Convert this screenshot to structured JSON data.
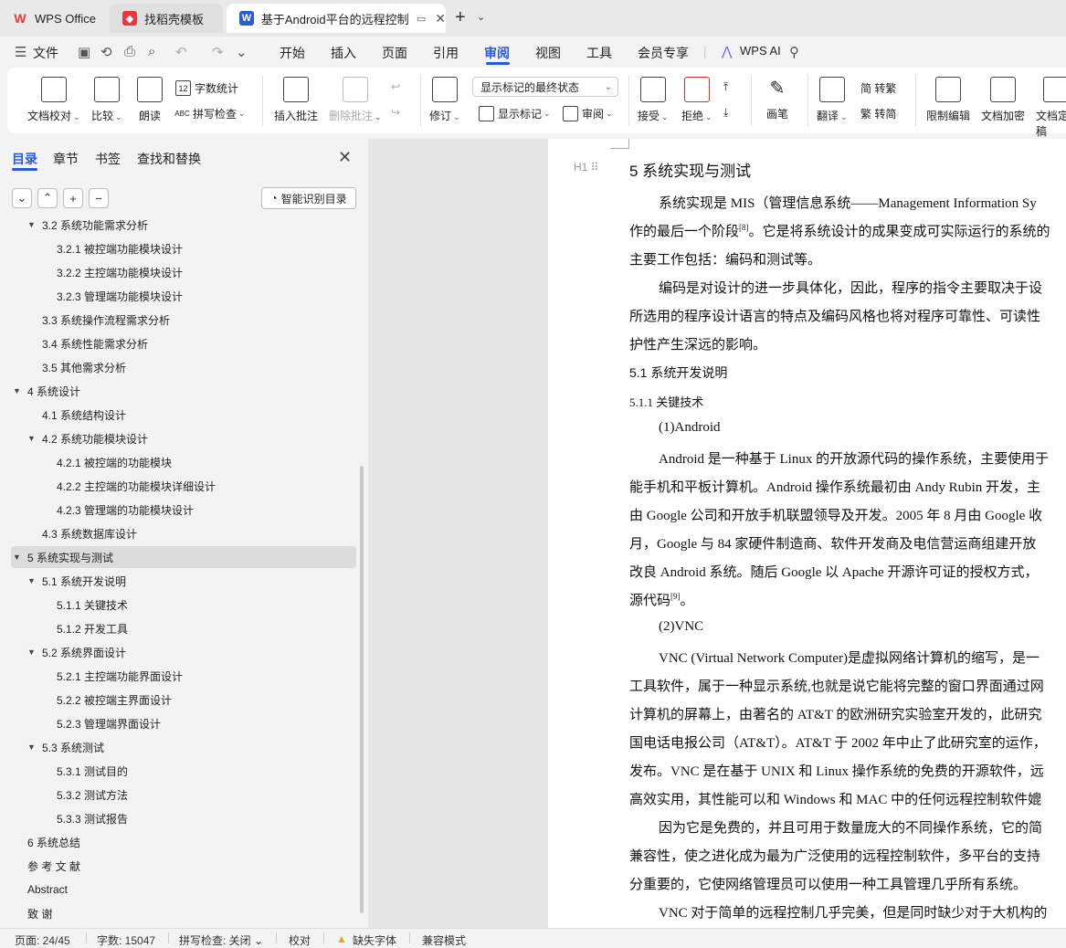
{
  "titlebar": {
    "tabs": [
      {
        "label": "WPS Office",
        "icon": "wps-icon",
        "color": "#e8383d"
      },
      {
        "label": "找稻壳模板",
        "icon": "docer-icon",
        "color": "#e8383d"
      },
      {
        "label": "基于Android平台的远程控制",
        "icon": "writer-icon",
        "color": "#2a5bd7"
      }
    ],
    "new_tab": "+"
  },
  "menubar": {
    "file": "文件",
    "items": [
      "开始",
      "插入",
      "页面",
      "引用",
      "审阅",
      "视图",
      "工具",
      "会员专享"
    ],
    "active": "审阅",
    "ai": "WPS AI"
  },
  "ribbon": {
    "doc_proofread": "文档校对",
    "compare": "比较",
    "read_aloud": "朗读",
    "word_count": "字数统计",
    "spell_check": "拼写检查",
    "insert_comment": "插入批注",
    "delete_comment": "删除批注",
    "revise": "修订",
    "markup_state": "显示标记的最终状态",
    "show_markup": "显示标记",
    "review": "审阅",
    "accept": "接受",
    "reject": "拒绝",
    "pen": "画笔",
    "translate": "翻译",
    "to_traditional": "简 转繁",
    "to_simplified": "繁 转简",
    "restrict_edit": "限制编辑",
    "encrypt": "文档加密",
    "finalize": "文档定稿"
  },
  "panel": {
    "tabs": [
      "目录",
      "章节",
      "书签",
      "查找和替换"
    ],
    "smart_toc": "智能识别目录",
    "toc": [
      {
        "label": "3.2  系统功能需求分析",
        "level": 2,
        "arrow": "▼"
      },
      {
        "label": "3.2.1  被控端功能模块设计",
        "level": 3
      },
      {
        "label": "3.2.2  主控端功能模块设计",
        "level": 3
      },
      {
        "label": "3.2.3  管理端功能模块设计",
        "level": 3
      },
      {
        "label": "3.3  系统操作流程需求分析",
        "level": 2
      },
      {
        "label": "3.4  系统性能需求分析",
        "level": 2
      },
      {
        "label": "3.5  其他需求分析",
        "level": 2
      },
      {
        "label": "4  系统设计",
        "level": 1,
        "arrow": "▼"
      },
      {
        "label": "4.1  系统结构设计",
        "level": 2
      },
      {
        "label": "4.2  系统功能模块设计",
        "level": 2,
        "arrow": "▼"
      },
      {
        "label": "4.2.1  被控端的功能模块",
        "level": 3
      },
      {
        "label": "4.2.2  主控端的功能模块详细设计",
        "level": 3
      },
      {
        "label": "4.2.3  管理端的功能模块设计",
        "level": 3
      },
      {
        "label": "4.3  系统数据库设计",
        "level": 2
      },
      {
        "label": "5  系统实现与测试",
        "level": 1,
        "arrow": "▼",
        "active": true
      },
      {
        "label": "5.1  系统开发说明",
        "level": 2,
        "arrow": "▼"
      },
      {
        "label": "5.1.1  关键技术",
        "level": 3
      },
      {
        "label": "5.1.2  开发工具",
        "level": 3
      },
      {
        "label": "5.2  系统界面设计",
        "level": 2,
        "arrow": "▼"
      },
      {
        "label": "5.2.1  主控端功能界面设计",
        "level": 3
      },
      {
        "label": "5.2.2  被控端主界面设计",
        "level": 3
      },
      {
        "label": "5.2.3  管理端界面设计",
        "level": 3
      },
      {
        "label": "5.3  系统测试",
        "level": 2,
        "arrow": "▼"
      },
      {
        "label": "5.3.1  测试目的",
        "level": 3
      },
      {
        "label": "5.3.2  测试方法",
        "level": 3
      },
      {
        "label": "5.3.3  测试报告",
        "level": 3
      },
      {
        "label": "6  系统总结",
        "level": 1
      },
      {
        "label": "参  考  文  献",
        "level": 1
      },
      {
        "label": "Abstract",
        "level": 1
      },
      {
        "label": "致      谢",
        "level": 1
      }
    ]
  },
  "document": {
    "lines": [
      "5   系统实现与测试",
      "系统实现是 MIS（管理信息系统——Management Information Sy",
      "作的最后一个阶段[8]。它是将系统设计的成果变成可实际运行的系统的",
      "主要工作包括：编码和测试等。",
      "编码是对设计的进一步具体化，因此，程序的指令主要取决于设",
      "所选用的程序设计语言的特点及编码风格也将对程序可靠性、可读性",
      "护性产生深远的影响。",
      "5.1  系统开发说明",
      "5.1.1   关键技术",
      "(1)Android",
      "Android 是一种基于 Linux 的开放源代码的操作系统，主要使用于",
      "能手机和平板计算机。Android 操作系统最初由 Andy Rubin 开发，主",
      "由 Google 公司和开放手机联盟领导及开发。2005 年 8 月由 Google 收",
      "月，Google 与 84 家硬件制造商、软件开发商及电信营运商组建开放",
      "改良 Android 系统。随后 Google 以 Apache 开源许可证的授权方式，",
      "源代码[9]。",
      "(2)VNC",
      "VNC (Virtual Network Computer)是虚拟网络计算机的缩写，是一",
      "工具软件，属于一种显示系统,也就是说它能将完整的窗口界面通过网",
      "计算机的屏幕上，由著名的 AT&T 的欧洲研究实验室开发的，此研究",
      "国电话电报公司（AT&T）。AT&T 于 2002 年中止了此研究室的运作，",
      "发布。VNC 是在基于 UNIX 和 Linux 操作系统的免费的开源软件，远",
      "高效实用，其性能可以和 Windows 和 MAC 中的任何远程控制软件媲",
      "因为它是免费的，并且可用于数量庞大的不同操作系统，它的简",
      "兼容性，使之进化成为最为广泛使用的远程控制软件，多平台的支持",
      "分重要的，它使网络管理员可以使用一种工具管理几乎所有系统。",
      "VNC 对于简单的远程控制几乎完美，但是同时缺少对于大机构的"
    ]
  },
  "statusbar": {
    "page": "页面: 24/45",
    "words": "字数: 15047",
    "spell": "拼写检查: 关闭",
    "proofread": "校对",
    "missing_font": "缺失字体",
    "compat": "兼容模式"
  },
  "colors": {
    "accent": "#2a5bd7",
    "active_row": "#dcdcdc"
  }
}
